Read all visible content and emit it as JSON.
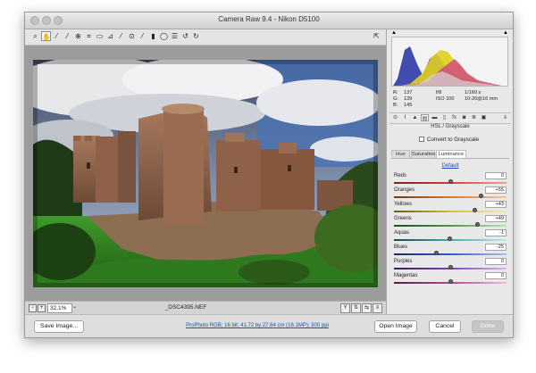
{
  "window": {
    "title": "Camera Raw 9.4  -  Nikon D5100"
  },
  "colors": {
    "accent": "#1d4fb5",
    "panel_bg": "#e8e8e8",
    "window_bg": "#d9d9d9"
  },
  "toolbar": {
    "tools": [
      {
        "name": "zoom-tool",
        "glyph": "⌕",
        "active": false
      },
      {
        "name": "hand-tool",
        "glyph": "✋",
        "active": true
      },
      {
        "name": "white-balance-tool",
        "glyph": "⁄",
        "active": false
      },
      {
        "name": "color-sampler-tool",
        "glyph": "⁄",
        "active": false
      },
      {
        "name": "targeted-adjustment-tool",
        "glyph": "⊕",
        "active": false
      },
      {
        "name": "crop-tool",
        "glyph": "⌗",
        "active": false
      },
      {
        "name": "straighten-tool",
        "glyph": "▭",
        "active": false
      },
      {
        "name": "transform-tool",
        "glyph": "⊿",
        "active": false
      },
      {
        "name": "spot-removal-tool",
        "glyph": "⁄",
        "active": false
      },
      {
        "name": "red-eye-tool",
        "glyph": "⊙",
        "active": false
      },
      {
        "name": "adjustment-brush-tool",
        "glyph": "⁄",
        "active": false
      },
      {
        "name": "graduated-filter-tool",
        "glyph": "▮",
        "active": false
      },
      {
        "name": "radial-filter-tool",
        "glyph": "◯",
        "active": false
      },
      {
        "name": "preferences-icon",
        "glyph": "☰",
        "active": false
      },
      {
        "name": "rotate-left-icon",
        "glyph": "↺",
        "active": false
      },
      {
        "name": "rotate-right-icon",
        "glyph": "↻",
        "active": false
      }
    ]
  },
  "status": {
    "zoom": "32.1%",
    "filename": "_DSC4395.NEF"
  },
  "footer": {
    "save_label": "Save Image...",
    "workflow": "ProPhoto RGB; 16 bit; 41.72 by 27.64 cm (16.1MP); 300 ppi",
    "open_label": "Open Image",
    "cancel_label": "Cancel",
    "done_label": "Done"
  },
  "readout": {
    "r_label": "R:",
    "r": "137",
    "g_label": "G:",
    "g": "139",
    "b_label": "B:",
    "b": "145",
    "aperture": "f/8",
    "shutter": "1/160 s",
    "iso": "ISO 100",
    "lens": "10-20@16 mm"
  },
  "panel": {
    "section_title": "HSL / Grayscale",
    "convert_label": "Convert to Grayscale",
    "subtabs": [
      "Hue",
      "Saturation",
      "Luminance"
    ],
    "active_subtab": 2,
    "default_link": "Default",
    "sliders": [
      {
        "label": "Reds",
        "value": "0",
        "level": 0,
        "track": "linear-gradient(90deg,#7a2020,#e03a2a,#f0a0a0)"
      },
      {
        "label": "Oranges",
        "value": "+55",
        "level": 55,
        "track": "linear-gradient(90deg,#6b3b12,#e07820,#f5c59a)"
      },
      {
        "label": "Yellows",
        "value": "+43",
        "level": 43,
        "track": "linear-gradient(90deg,#6a5a14,#d8c030,#f4eab0)"
      },
      {
        "label": "Greens",
        "value": "+49",
        "level": 49,
        "track": "linear-gradient(90deg,#1e4d1e,#3ca040,#b8e6b0)"
      },
      {
        "label": "Aquas",
        "value": "-1",
        "level": -1,
        "track": "linear-gradient(90deg,#1c4a4a,#40b0b0,#b8e8e8)"
      },
      {
        "label": "Blues",
        "value": "-25",
        "level": -25,
        "track": "linear-gradient(90deg,#1c2a6a,#3058d0,#b0c0f0)"
      },
      {
        "label": "Purples",
        "value": "0",
        "level": 0,
        "track": "linear-gradient(90deg,#3a1c5a,#8040c0,#d8b8f0)"
      },
      {
        "label": "Magentas",
        "value": "0",
        "level": 0,
        "track": "linear-gradient(90deg,#5a1c4a,#c040a0,#f0b8e0)"
      }
    ]
  }
}
